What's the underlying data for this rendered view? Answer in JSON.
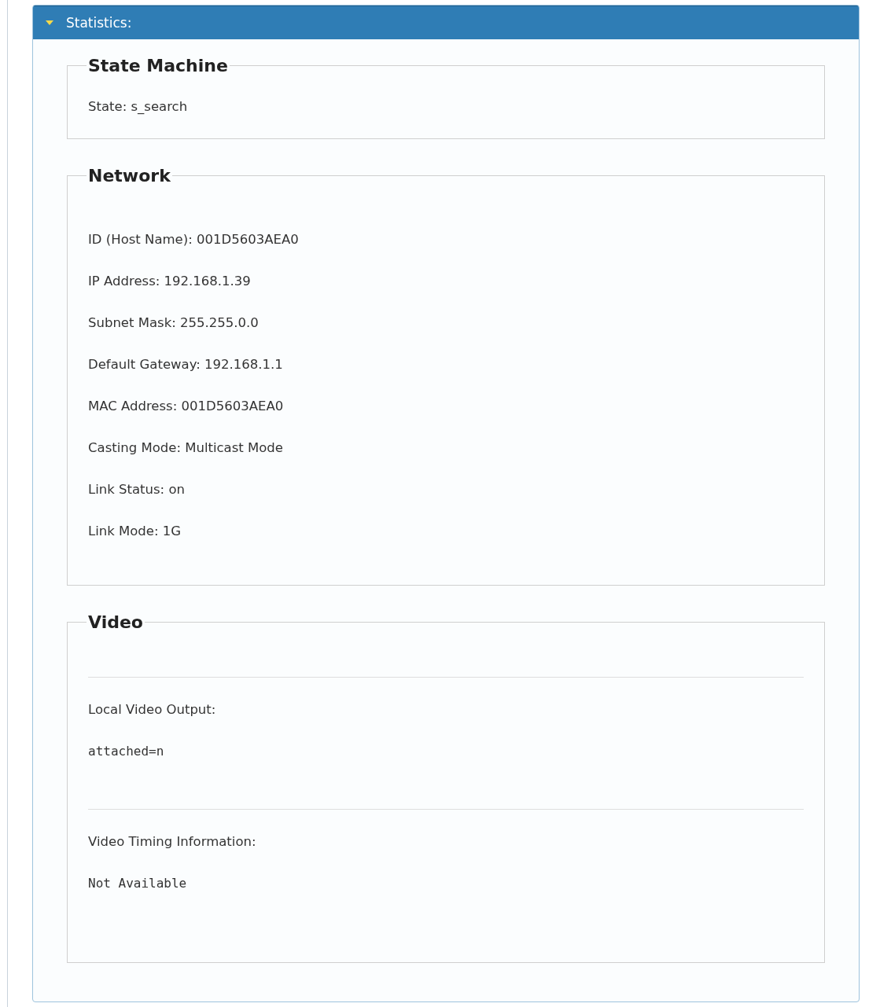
{
  "panel": {
    "title": "Statistics:",
    "expanded": true,
    "sections": [
      {
        "title": "State Machine",
        "kind": "lines",
        "lines": [
          "State: s_search"
        ]
      },
      {
        "title": "Network",
        "kind": "lines",
        "lines": [
          "ID (Host Name): 001D5603AEA0",
          "IP Address: 192.168.1.39",
          "Subnet Mask: 255.255.0.0",
          "Default Gateway: 192.168.1.1",
          "MAC Address: 001D5603AEA0",
          "Casting Mode: Multicast Mode",
          "Link Status: on",
          "Link Mode: 1G"
        ]
      },
      {
        "title": "Video",
        "kind": "groups",
        "groups": [
          {
            "label": "Local Video Output:",
            "value": "attached=n"
          },
          {
            "label": "Video Timing Information:",
            "value": "Not Available"
          }
        ]
      }
    ]
  }
}
